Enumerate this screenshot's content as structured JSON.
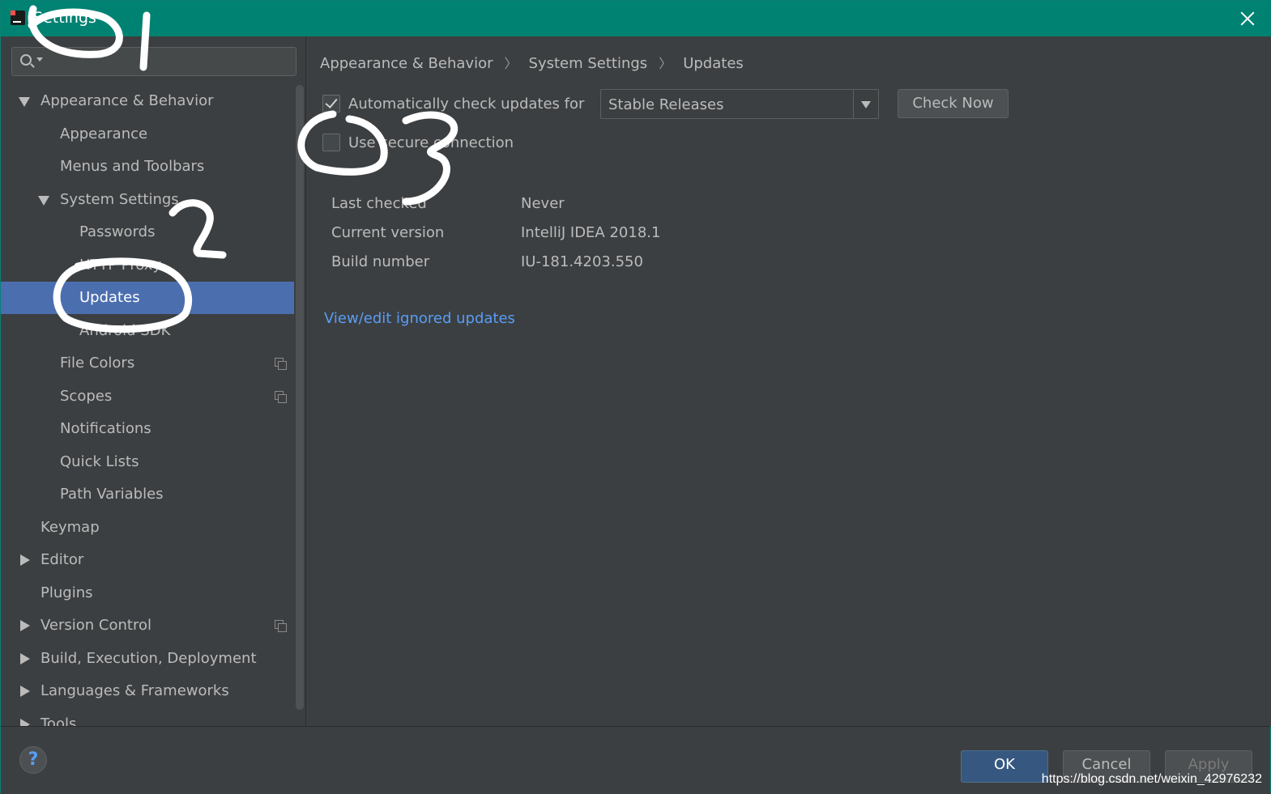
{
  "window": {
    "title": "Settings"
  },
  "search": {
    "placeholder": ""
  },
  "tree": [
    {
      "label": "Appearance & Behavior",
      "expander": "expanded"
    },
    {
      "label": "Appearance"
    },
    {
      "label": "Menus and Toolbars"
    },
    {
      "label": "System Settings",
      "expander": "expanded"
    },
    {
      "label": "Passwords"
    },
    {
      "label": "HTTP Proxy"
    },
    {
      "label": "Updates",
      "selected": true
    },
    {
      "label": "Android SDK"
    },
    {
      "label": "File Colors",
      "copy_icon": true
    },
    {
      "label": "Scopes",
      "copy_icon": true
    },
    {
      "label": "Notifications"
    },
    {
      "label": "Quick Lists"
    },
    {
      "label": "Path Variables"
    },
    {
      "label": "Keymap"
    },
    {
      "label": "Editor",
      "expander": "collapsed"
    },
    {
      "label": "Plugins"
    },
    {
      "label": "Version Control",
      "expander": "collapsed",
      "copy_icon": true
    },
    {
      "label": "Build, Execution, Deployment",
      "expander": "collapsed"
    },
    {
      "label": "Languages & Frameworks",
      "expander": "collapsed"
    },
    {
      "label": "Tools",
      "expander": "collapsed"
    }
  ],
  "breadcrumb": [
    "Appearance & Behavior",
    "System Settings",
    "Updates"
  ],
  "updates": {
    "auto_check_label": "Automatically check updates for",
    "auto_check_checked": true,
    "channel_value": "Stable Releases",
    "check_now_label": "Check Now",
    "secure_label": "Use secure connection",
    "secure_checked": false,
    "info": [
      {
        "label": "Last checked",
        "value": "Never"
      },
      {
        "label": "Current version",
        "value": "IntelliJ IDEA 2018.1"
      },
      {
        "label": "Build number",
        "value": "IU-181.4203.550"
      }
    ],
    "ignored_link": "View/edit ignored updates"
  },
  "footer": {
    "help_label": "?",
    "ok_label": "OK",
    "cancel_label": "Cancel",
    "apply_label": "Apply",
    "watermark": "https://blog.csdn.net/weixin_42976232"
  },
  "colors": {
    "titlebar": "#008272",
    "selection": "#4b6eaf",
    "link": "#589df6",
    "ok_button": "#365880"
  }
}
